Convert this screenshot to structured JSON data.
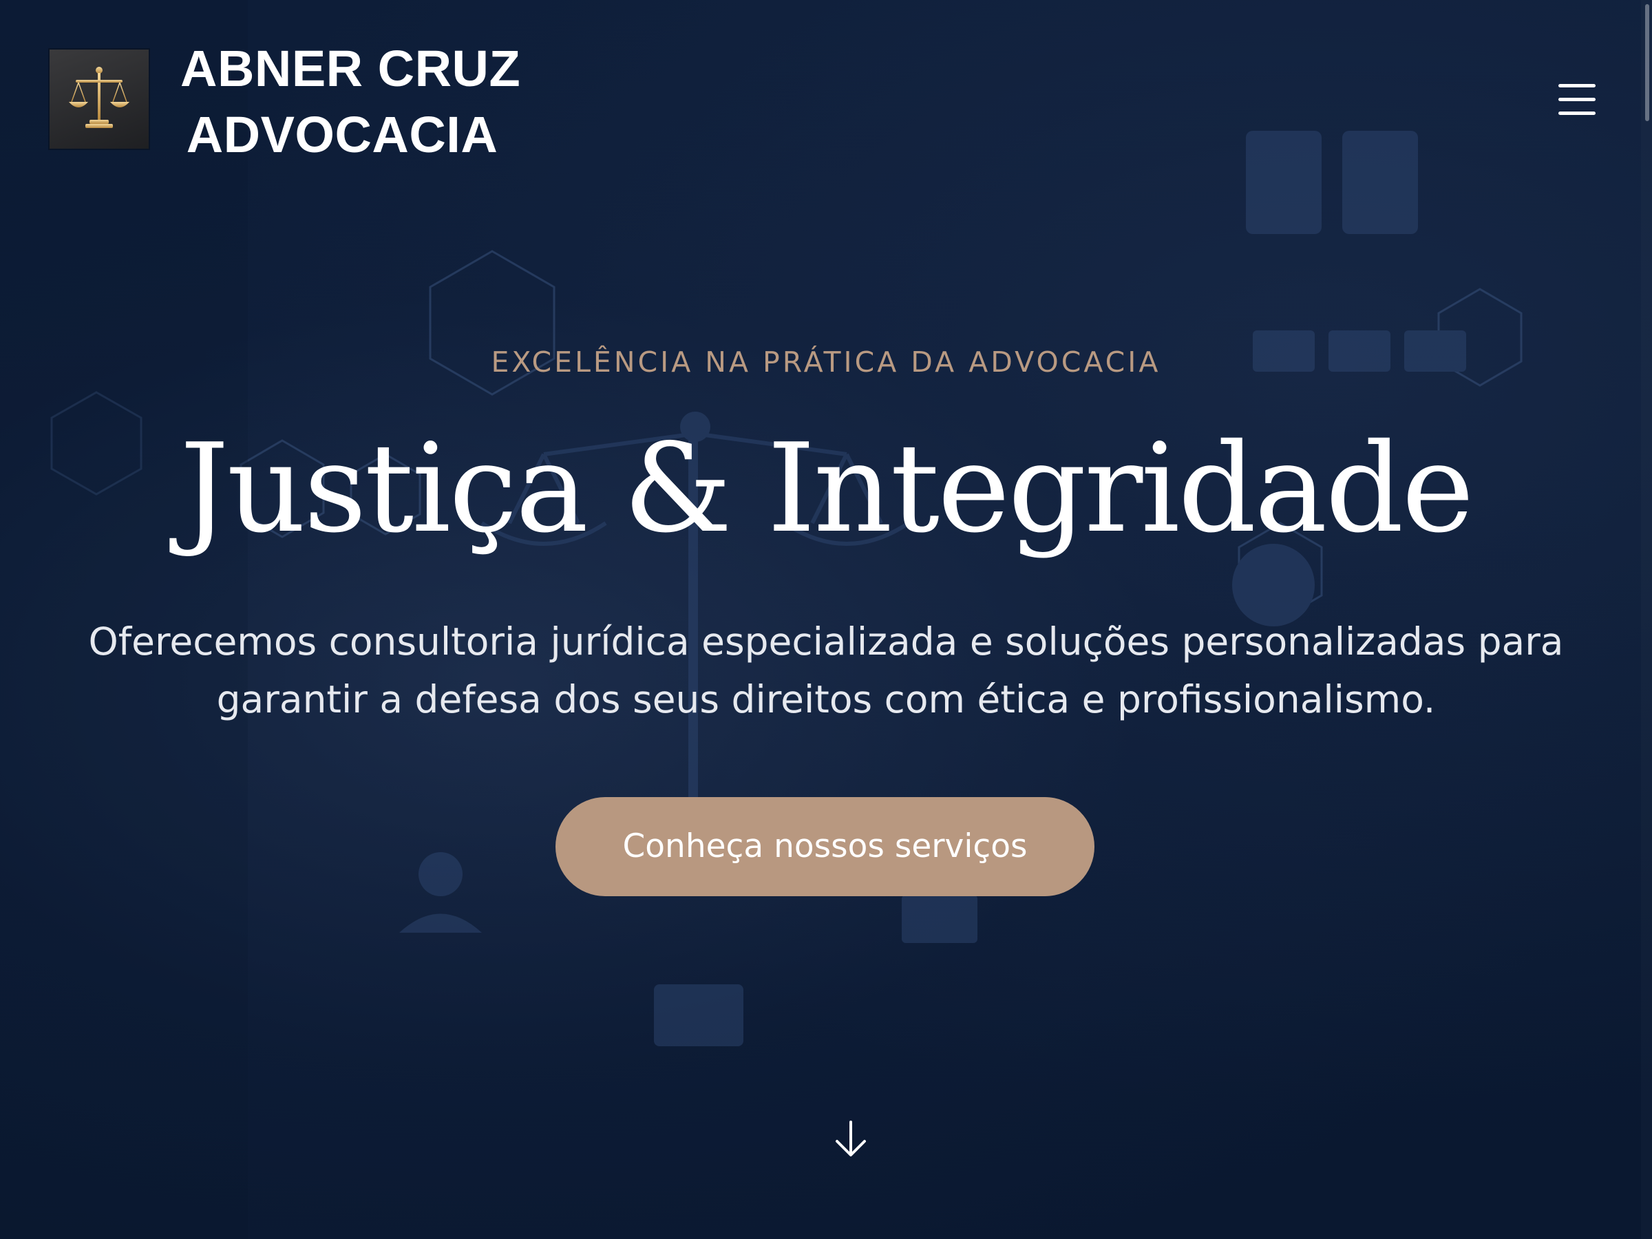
{
  "header": {
    "logo_icon": "scales-of-justice-icon",
    "brand_line1": "ABNER CRUZ",
    "brand_line2": "ADVOCACIA",
    "menu_icon": "hamburger-menu-icon"
  },
  "hero": {
    "eyebrow": "EXCELÊNCIA NA PRÁTICA DA ADVOCACIA",
    "title": "Justiça & Integridade",
    "subtitle": "Oferecemos consultoria jurídica especializada e soluções personalizadas para garantir a defesa dos seus direitos com ética e profissionalismo.",
    "cta_label": "Conheça nossos serviços",
    "scroll_icon": "arrow-down-icon"
  },
  "colors": {
    "background": "#0b1a33",
    "accent": "#b89880",
    "eyebrow": "#b99a82",
    "text": "#ffffff"
  }
}
